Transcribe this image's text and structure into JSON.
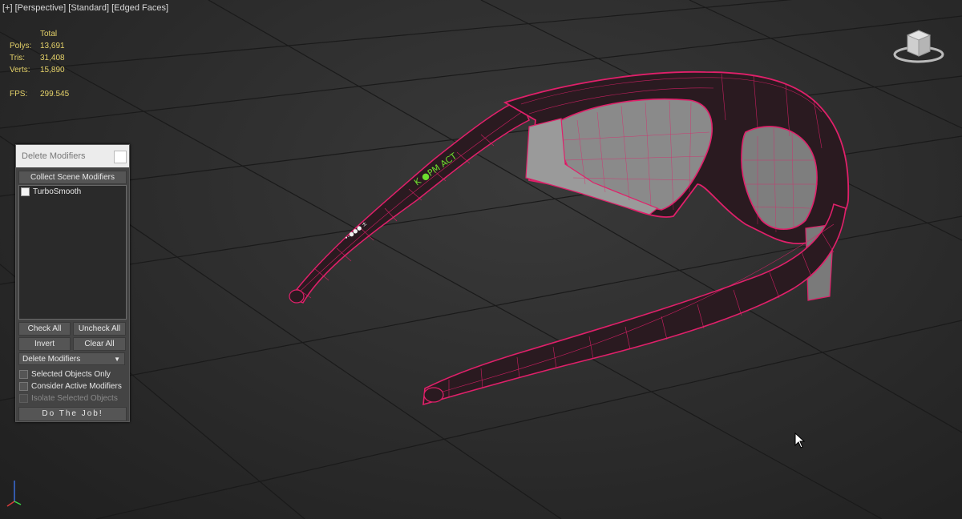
{
  "viewport": {
    "label_parts": [
      "[+]",
      "[Perspective]",
      "[Standard]",
      "[Edged Faces]"
    ],
    "stats": {
      "header": "Total",
      "rows": [
        {
          "label": "Polys:",
          "value": "13,691"
        },
        {
          "label": "Tris:",
          "value": "31,408"
        },
        {
          "label": "Verts:",
          "value": "15,890"
        }
      ],
      "fps_label": "FPS:",
      "fps_value": "299.545"
    },
    "model_text": {
      "temple_left": "K ●PM ACT",
      "arm_left": "•-●●● ±"
    }
  },
  "panel": {
    "title": "Delete Modifiers",
    "collect_button": "Collect Scene Modifiers",
    "modifiers": [
      {
        "name": "TurboSmooth",
        "checked": false
      }
    ],
    "check_all": "Check All",
    "uncheck_all": "Uncheck All",
    "invert": "Invert",
    "clear_all": "Clear All",
    "mode_selected": "Delete Modifiers",
    "options": [
      {
        "label": "Selected Objects Only",
        "checked": false,
        "enabled": true
      },
      {
        "label": "Consider Active Modifiers",
        "checked": false,
        "enabled": true
      },
      {
        "label": "Isolate Selected Objects",
        "checked": false,
        "enabled": false
      }
    ],
    "do_job": "Do The Job!"
  },
  "colors": {
    "wire": "#e0206a",
    "stats": "#e6d36a",
    "lens": "#8a8a8a",
    "frame": "#2a1a20"
  }
}
